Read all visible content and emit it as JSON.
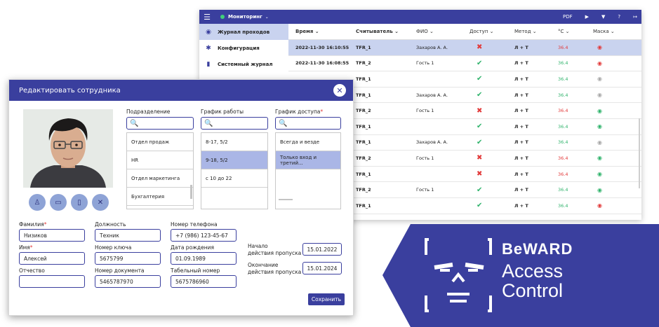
{
  "monitor": {
    "title": "Мониторинг",
    "toolbar": {
      "pdf": "PDF",
      "play": "▶",
      "filter": "▼",
      "help": "?",
      "exit": "↦"
    },
    "menu": [
      {
        "label": "Журнал проходов",
        "icon": "eye-icon",
        "glyph": "◉"
      },
      {
        "label": "Конфигурация",
        "icon": "gear-icon",
        "glyph": "✱"
      },
      {
        "label": "Системный журнал",
        "icon": "journal-icon",
        "glyph": "▮"
      }
    ],
    "columns": [
      "Время",
      "Считыватель",
      "ФИО",
      "Доступ",
      "Метод",
      "°C",
      "Маска"
    ],
    "rows": [
      {
        "time": "2022-11-30 16:10:55",
        "reader": "TFR_1",
        "fio": "Захаров А. А.",
        "access": "deny",
        "method": "Л + Т",
        "temp": "36.4",
        "mask": "red"
      },
      {
        "time": "2022-11-30 16:08:55",
        "reader": "TFR_2",
        "fio": "Гость 1",
        "access": "ok",
        "method": "Л + Т",
        "temp": "36.4",
        "mask": "red"
      },
      {
        "time": "",
        "reader": "TFR_1",
        "fio": "",
        "access": "ok",
        "method": "Л + Т",
        "temp": "36.4",
        "mask": "gray"
      },
      {
        "time": "",
        "reader": "TFR_1",
        "fio": "Захаров А. А.",
        "access": "ok",
        "method": "Л + Т",
        "temp": "36.4",
        "mask": "gray"
      },
      {
        "time": "",
        "reader": "TFR_2",
        "fio": "Гость 1",
        "access": "deny",
        "method": "Л + Т",
        "temp": "36.4",
        "mask": "green"
      },
      {
        "time": "",
        "reader": "TFR_1",
        "fio": "",
        "access": "ok",
        "method": "Л + Т",
        "temp": "36.4",
        "mask": "green"
      },
      {
        "time": "",
        "reader": "TFR_1",
        "fio": "Захаров А. А.",
        "access": "ok",
        "method": "Л + Т",
        "temp": "36.4",
        "mask": "gray"
      },
      {
        "time": "",
        "reader": "TFR_2",
        "fio": "Гость 1",
        "access": "deny",
        "method": "Л + Т",
        "temp": "36.4",
        "mask": "green"
      },
      {
        "time": "",
        "reader": "TFR_1",
        "fio": "",
        "access": "deny",
        "method": "Л + Т",
        "temp": "36.4",
        "mask": "green"
      },
      {
        "time": "",
        "reader": "TFR_2",
        "fio": "Гость 1",
        "access": "ok",
        "method": "Л + Т",
        "temp": "36.4",
        "mask": "green"
      },
      {
        "time": "",
        "reader": "TFR_1",
        "fio": "",
        "access": "ok",
        "method": "Л + Т",
        "temp": "36.4",
        "mask": "red"
      }
    ]
  },
  "dialog": {
    "title": "Редактировать сотрудника",
    "close": "✕",
    "photo_buttons": [
      {
        "icon": "badge-icon",
        "glyph": "♙"
      },
      {
        "icon": "card-icon",
        "glyph": "▭"
      },
      {
        "icon": "device-icon",
        "glyph": "▯"
      },
      {
        "icon": "remove-icon",
        "glyph": "✕"
      }
    ],
    "departments": {
      "label": "Подразделение",
      "items": [
        "Отдел продаж",
        "HR",
        "Отдел маркетинга",
        "Бухгалтерия"
      ]
    },
    "work_schedule": {
      "label": "График работы",
      "items": [
        "8-17, 5/2",
        "9-18, 5/2",
        "с 10 до 22"
      ],
      "selected": 1
    },
    "access_schedule": {
      "label": "График доступа",
      "required": "*",
      "items": [
        "Всегда и везде",
        "Только вход и третий..."
      ],
      "selected": 1
    },
    "search_glyph": "🔍",
    "fields": {
      "last_name": {
        "label": "Фамилия",
        "required": "*",
        "value": "Низиков"
      },
      "position": {
        "label": "Должность",
        "value": "Техник"
      },
      "phone": {
        "label": "Номер телефона",
        "value": "+7 (986) 123-45-67"
      },
      "first_name": {
        "label": "Имя",
        "required": "*",
        "value": "Алексей"
      },
      "key_number": {
        "label": "Номер ключа",
        "value": "5675799"
      },
      "birth_date": {
        "label": "Дата рождения",
        "value": "01.09.1989"
      },
      "patronymic": {
        "label": "Отчество",
        "value": ""
      },
      "doc_number": {
        "label": "Номер документа",
        "value": "5465787970"
      },
      "tab_number": {
        "label": "Табельный номер",
        "value": "5675786960"
      },
      "pass_start": {
        "label_1": "Начало",
        "label_2": "действия пропуска",
        "value": "15.01.2022"
      },
      "pass_end": {
        "label_1": "Окончание",
        "label_2": "действия пропуска",
        "value": "15.01.2024"
      }
    },
    "save_label": "Сохранить"
  },
  "brand": {
    "line1": "BeWARD",
    "line2": "Access",
    "line3": "Control"
  },
  "colors": {
    "primary": "#3a3f9e",
    "selected": "#c9d3ef",
    "ok": "#2fb36b",
    "deny": "#e23a3a",
    "temp_ok": "#2fb36b",
    "temp_bad": "#e23a3a"
  }
}
